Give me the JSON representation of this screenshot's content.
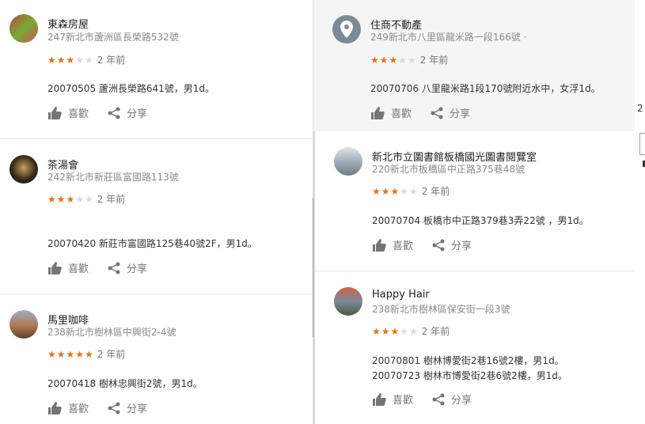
{
  "left_reviews": [
    {
      "name": "東森房屋",
      "address": "247新北市蘆洲區長榮路532號",
      "rating": 3,
      "age": "2 年前",
      "text": [
        "20070505  蘆洲長榮路641號，男1d。"
      ],
      "like": "喜歡",
      "share": "分享"
    },
    {
      "name": "茶湯會",
      "address": "242新北市新莊區富國路113號",
      "rating": 3,
      "age": "2 年前",
      "text": [
        "20070420  新莊市富國路125巷40號2F，男1d。"
      ],
      "like": "喜歡",
      "share": "分享"
    },
    {
      "name": "馬里咖啡",
      "address": "238新北市樹林區中興街2-4號",
      "rating": 5,
      "age": "2 年前",
      "text": [
        "20070418  樹林忠興街2號，男1d。"
      ],
      "like": "喜歡",
      "share": "分享"
    }
  ],
  "right_reviews": [
    {
      "name": "住商不動產",
      "address": "249新北市八里區龍米路一段166號 ·",
      "rating": 3,
      "age": "2 年前",
      "text": [
        "20070706  八里龍米路1段170號附近水中，女浮1d。"
      ],
      "like": "喜歡",
      "share": "分享"
    },
    {
      "name": "新北市立圖書館板橋國光圖書閱覽室",
      "address": "220新北市板橋區中正路375巷48號",
      "rating": 3,
      "age": "2 年前",
      "text": [
        "20070704  板橋市中正路379巷3弄22號 ，男1d。"
      ],
      "like": "喜歡",
      "share": "分享"
    },
    {
      "name": "Happy Hair",
      "address": "238新北市樹林區保安街一段3號",
      "rating": 3,
      "age": "2 年前",
      "text": [
        "20070801  樹林博愛街2巷16號2樓，男1d。",
        "20070723  樹林市博愛街2巷6號2樓，男1d。"
      ],
      "like": "喜歡",
      "share": "分享"
    }
  ],
  "edge_text": "2",
  "colors": {
    "star_on": "#e7711b",
    "star_off": "#dadada",
    "muted": "#8a8a8a"
  }
}
